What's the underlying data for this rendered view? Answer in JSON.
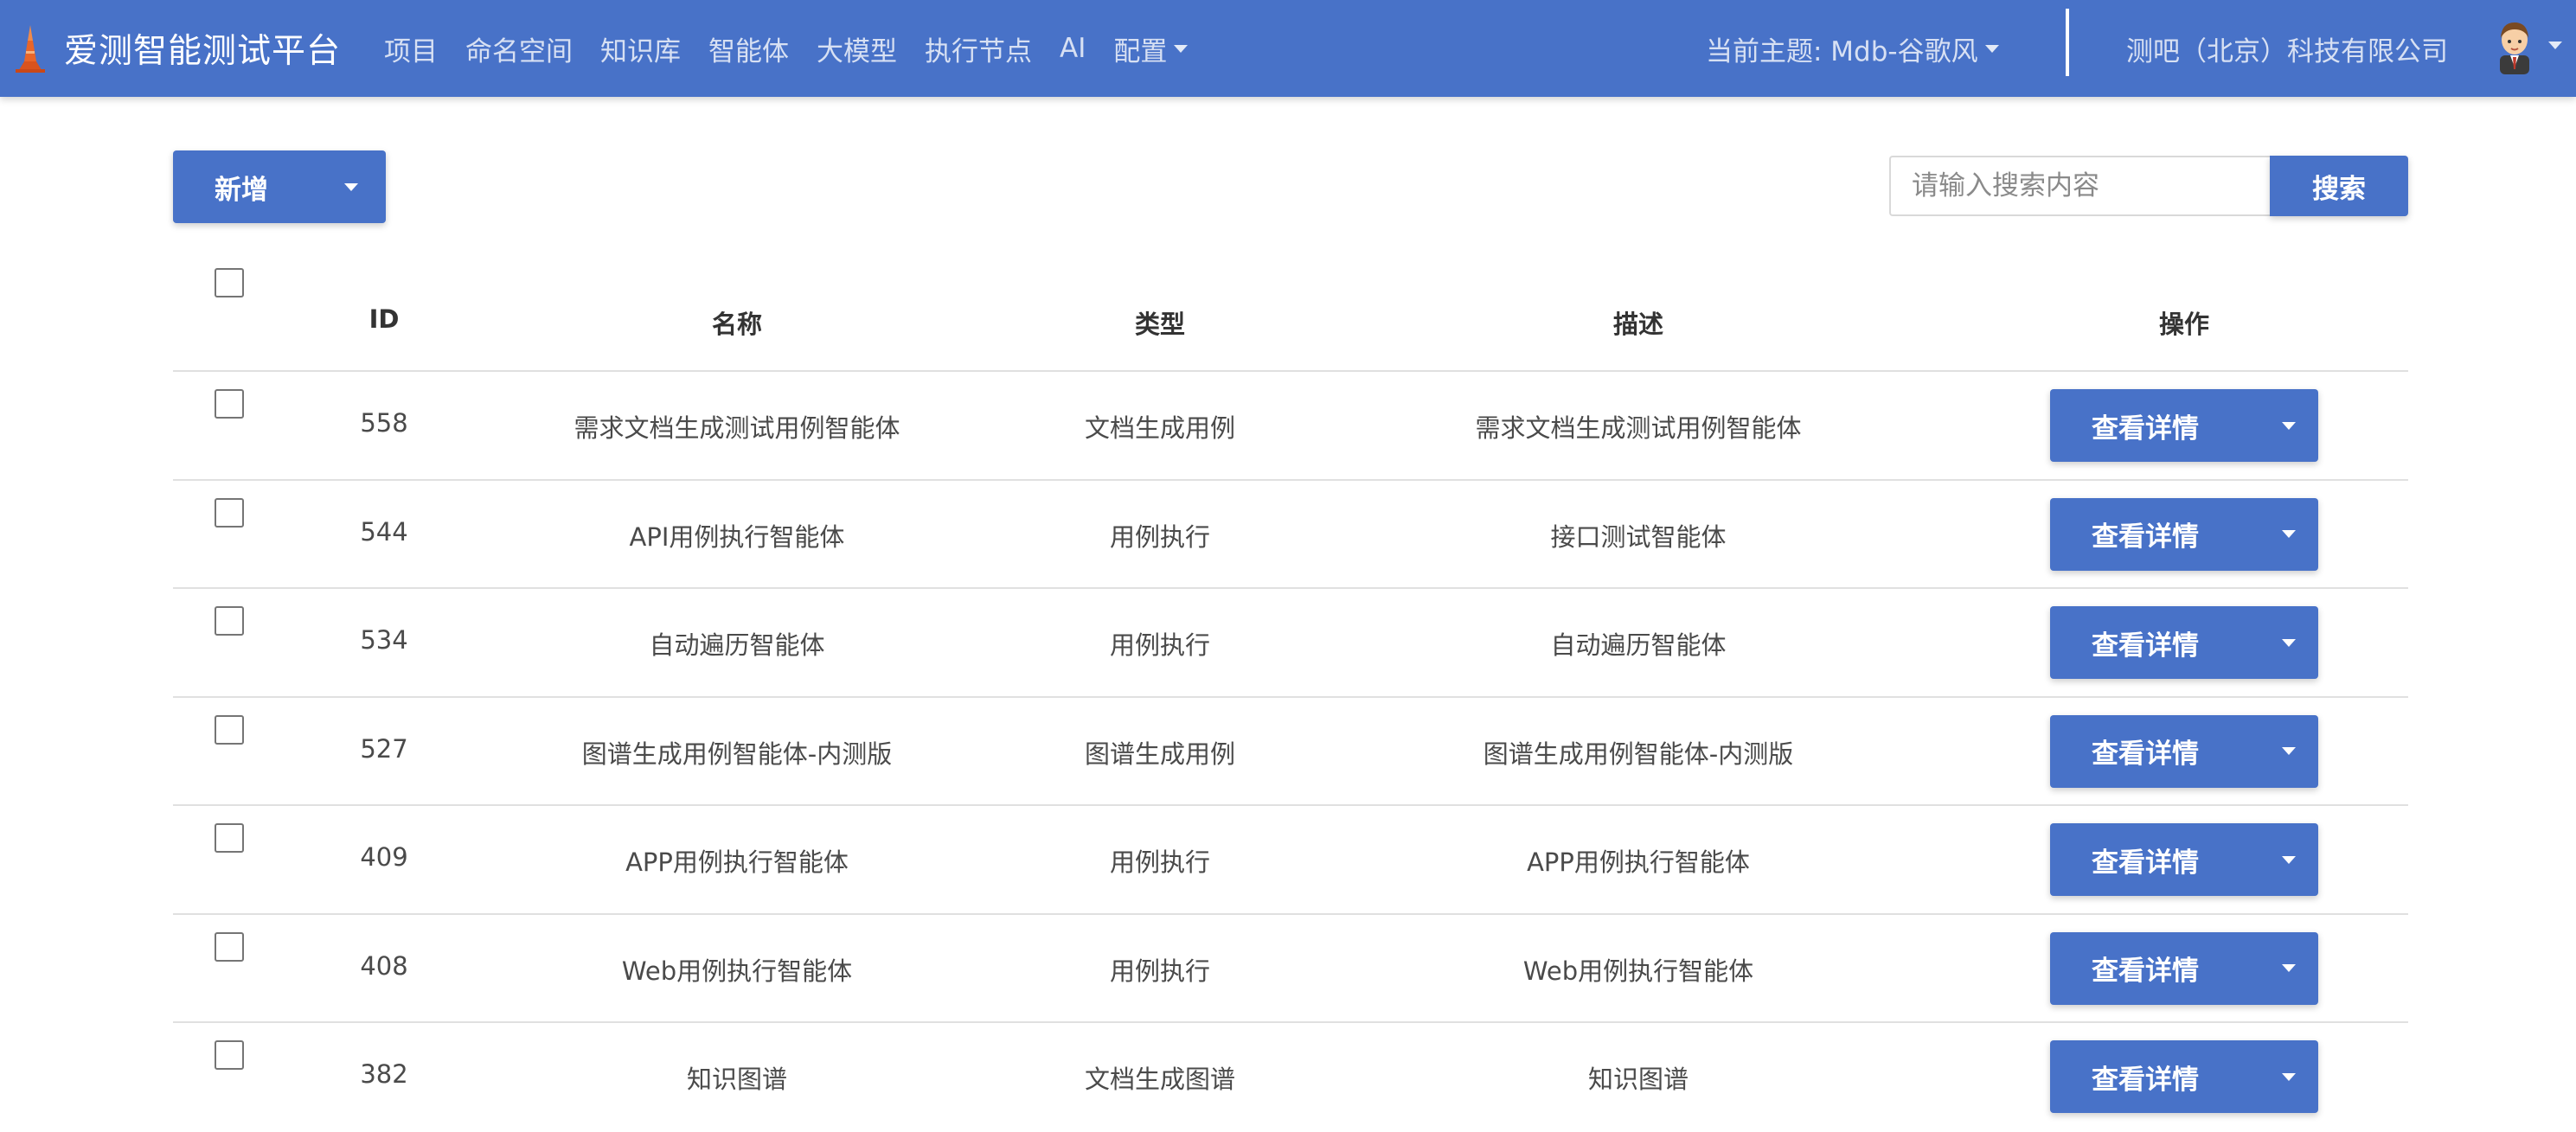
{
  "navbar": {
    "brand_title": "爱测智能测试平台",
    "links": [
      {
        "label": "项目",
        "has_caret": false
      },
      {
        "label": "命名空间",
        "has_caret": false
      },
      {
        "label": "知识库",
        "has_caret": false
      },
      {
        "label": "智能体",
        "has_caret": false
      },
      {
        "label": "大模型",
        "has_caret": false
      },
      {
        "label": "执行节点",
        "has_caret": false
      },
      {
        "label": "AI",
        "has_caret": false
      },
      {
        "label": "配置",
        "has_caret": true
      }
    ],
    "theme_label": "当前主题: Mdb-谷歌风",
    "company": "测吧（北京）科技有限公司",
    "bg_color": "#4872c8"
  },
  "toolbar": {
    "add_label": "新增",
    "search_placeholder": "请输入搜索内容",
    "search_value": "",
    "search_button": "搜索"
  },
  "table": {
    "headers": {
      "id": "ID",
      "name": "名称",
      "type": "类型",
      "description": "描述",
      "actions": "操作"
    },
    "detail_button_label": "查看详情",
    "rows": [
      {
        "id": "558",
        "name": "需求文档生成测试用例智能体",
        "type": "文档生成用例",
        "description": "需求文档生成测试用例智能体"
      },
      {
        "id": "544",
        "name": "API用例执行智能体",
        "type": "用例执行",
        "description": "接口测试智能体"
      },
      {
        "id": "534",
        "name": "自动遍历智能体",
        "type": "用例执行",
        "description": "自动遍历智能体"
      },
      {
        "id": "527",
        "name": "图谱生成用例智能体-内测版",
        "type": "图谱生成用例",
        "description": "图谱生成用例智能体-内测版"
      },
      {
        "id": "409",
        "name": "APP用例执行智能体",
        "type": "用例执行",
        "description": "APP用例执行智能体"
      },
      {
        "id": "408",
        "name": "Web用例执行智能体",
        "type": "用例执行",
        "description": "Web用例执行智能体"
      },
      {
        "id": "382",
        "name": "知识图谱",
        "type": "文档生成图谱",
        "description": "知识图谱"
      }
    ]
  },
  "icons": {
    "logo": "tower-logo-icon",
    "avatar": "user-avatar",
    "caret": "chevron-down-icon",
    "checkbox": "checkbox-unchecked"
  }
}
